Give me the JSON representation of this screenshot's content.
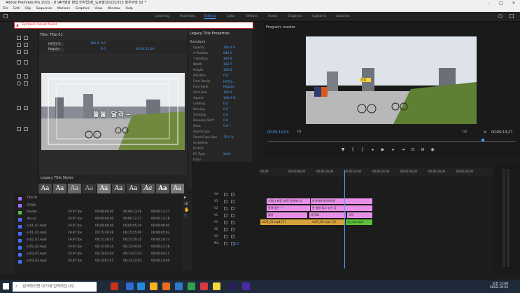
{
  "window": {
    "title": "Adobe Premiere Pro 2021 - D:\\#H영상 편집 미작업\\화_도로발\\20221015 칠우부엉 02 *"
  },
  "menu": [
    "File",
    "Edit",
    "Clip",
    "Sequence",
    "Markers",
    "Graphics",
    "View",
    "Window",
    "Help"
  ],
  "workspaces": [
    "Learning",
    "Assembly",
    "Editing",
    "Color",
    "Effects",
    "Audio",
    "Graphics",
    "Captions",
    "Libraries"
  ],
  "active_workspace": "Editing",
  "warning": {
    "text": "Symbols cannot found"
  },
  "title_editor": {
    "header": "Title: Title 01",
    "font": "HY견고딕",
    "style": "Regular",
    "size": "100.0",
    "kerning": "0.0",
    "leading": "0.0",
    "timecode": "00;00;12;04",
    "caption": "둘둘 달라~"
  },
  "properties": {
    "header": "Legacy Title Properties",
    "sections": [
      "Transform",
      "Properties",
      "Fill"
    ],
    "rows": [
      {
        "k": "Opacity",
        "v": "100.0 %"
      },
      {
        "k": "X Position",
        "v": "649.1"
      },
      {
        "k": "Y Position",
        "v": "260.0"
      },
      {
        "k": "Width",
        "v": "362.7"
      },
      {
        "k": "Height",
        "v": "100.0"
      },
      {
        "k": "Rotation",
        "v": "0.0 °"
      },
      {
        "k": "Font Family",
        "v": "HY견고..."
      },
      {
        "k": "Font Style",
        "v": "Regular"
      },
      {
        "k": "Font Size",
        "v": "100.0"
      },
      {
        "k": "Aspect",
        "v": "100.0 %"
      },
      {
        "k": "Leading",
        "v": "0.0"
      },
      {
        "k": "Kerning",
        "v": "0.0"
      },
      {
        "k": "Tracking",
        "v": "0.0"
      },
      {
        "k": "Baseline Shift",
        "v": "0.0"
      },
      {
        "k": "Slant",
        "v": "0.0 °"
      },
      {
        "k": "Small Caps",
        "v": ""
      },
      {
        "k": "Small Caps Size",
        "v": "75.0 %"
      },
      {
        "k": "Underline",
        "v": ""
      },
      {
        "k": "Distort",
        "v": ""
      },
      {
        "k": "Fill Type",
        "v": "Solid"
      },
      {
        "k": "Color",
        "v": ""
      },
      {
        "k": "Opacity",
        "v": "100 %"
      },
      {
        "k": "Sheen",
        "v": ""
      },
      {
        "k": "Texture",
        "v": ""
      }
    ]
  },
  "styles": {
    "header": "Legacy Title Styles",
    "swatch": "Aa"
  },
  "program": {
    "header": "Program: master",
    "timecode": "00;00;12;04",
    "duration": "00;00;13;27",
    "fit": "Fit",
    "ratio": "1/2",
    "sign": "다움"
  },
  "project": {
    "rows": [
      {
        "n": "Title 01",
        "c1": "",
        "c2": "",
        "c3": "",
        "c4": "",
        "color": "#a070ff"
      },
      {
        "n": "자막01",
        "c1": "",
        "c2": "",
        "c3": "",
        "c4": "",
        "color": "#a070ff"
      },
      {
        "n": "master",
        "c1": "29.97 fps",
        "c2": "00;00;00;00",
        "c3": "00;00;13;26",
        "c4": "00;00;13;27",
        "color": "#5cbf3a"
      },
      {
        "n": "dk-cyc",
        "c1": "29.97 fps",
        "c2": "00;00;00;00",
        "c3": "00;00;12;17",
        "c4": "00;00;12;18",
        "color": "#4a6eff"
      },
      {
        "n": "sc01_01.mp4",
        "c1": "29.97 fps",
        "c2": "00;00;00;00",
        "c3": "00;00;05;29",
        "c4": "00;00;06;00",
        "color": "#4a6eff"
      },
      {
        "n": "sc01_02.mp4",
        "c1": "29.97 fps",
        "c2": "00;15;49;28",
        "c3": "00;15;55;00",
        "c4": "00;00;05;03",
        "color": "#4a6eff"
      },
      {
        "n": "sc02_01.mp4",
        "c1": "29.97 fps",
        "c2": "00;11;26;21",
        "c3": "00;11;50;12",
        "c4": "00;00;24;13",
        "color": "#4a6eff"
      },
      {
        "n": "sc02_02.mp4",
        "c1": "29.97 fps",
        "c2": "00;11;56;14",
        "c3": "00;12;44;02",
        "c4": "00;00;47;18",
        "color": "#4a6eff"
      },
      {
        "n": "sc03_01.mp4",
        "c1": "29.97 fps",
        "c2": "00;13;03;04",
        "c3": "00;13;07;24",
        "c4": "00;00;04;21",
        "color": "#4a6eff"
      },
      {
        "n": "sc03_02.mp4",
        "c1": "29.97 fps",
        "c2": "00;13;07;25",
        "c3": "00;13;22;03",
        "c4": "00;00;14;09",
        "color": "#4a6eff"
      }
    ]
  },
  "timeline": {
    "ticks": [
      "00;00",
      "00;00;08;00",
      "00;00;10;00",
      "00;00;12;00",
      "00;00;14;00",
      "00;00;16;00",
      "00;00;18;00",
      "00;00;20;00"
    ],
    "tracks": [
      "V4",
      "V3",
      "V2",
      "V1",
      "A1",
      "A2",
      "A3",
      "Mix"
    ],
    "mix_value": "0.0",
    "clips": [
      {
        "label": "그렇다 표정 (자막 번역조) 성",
        "color": "#e890e8",
        "track": 0
      },
      {
        "label": "하하하하하하하하하",
        "color": "#e890e8",
        "track": 0
      },
      {
        "label": "둘려자전——",
        "color": "#e890e8",
        "track": 1
      },
      {
        "label": "한 형형 참고 성수 공",
        "color": "#e890e8",
        "track": 1
      },
      {
        "label": "월일",
        "color": "#e890e8",
        "track": 2
      },
      {
        "label": "자막01",
        "color": "#e890e8",
        "track": 2
      },
      {
        "label": "자막",
        "color": "#e890e8",
        "track": 2
      },
      {
        "label": "sc01_01.mp4 [V]",
        "color": "#d7a33a",
        "track": 3
      },
      {
        "label": "sc01_02.mp4 [V]",
        "color": "#d7a33a",
        "track": 3
      },
      {
        "label": "sc_cus.mp4",
        "color": "#5cbf3a",
        "track": 3
      }
    ]
  },
  "taskbar": {
    "search": "검색하려면 여기에 입력하십시오.",
    "time": "오후 12:09",
    "date": "2022-10-22"
  }
}
